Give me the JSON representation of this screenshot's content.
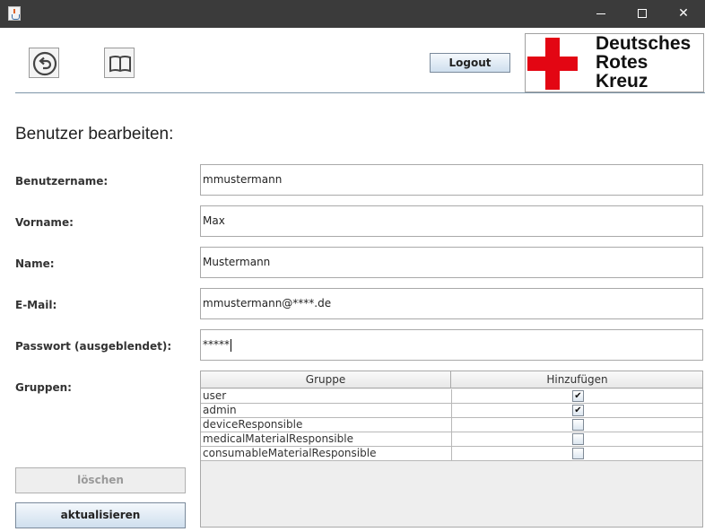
{
  "window": {
    "minimize_icon": "minimize-icon",
    "maximize_icon": "maximize-icon",
    "close_icon": "close-icon",
    "close_glyph": "✕"
  },
  "toolbar": {
    "back_icon": "back-arrow-icon",
    "manual_icon": "book-icon",
    "logout_label": "Logout"
  },
  "logo": {
    "lines": [
      "Deutsches",
      "Rotes",
      "Kreuz"
    ],
    "color": "#e30613"
  },
  "page": {
    "heading": "Benutzer bearbeiten:"
  },
  "form": {
    "username": {
      "label": "Benutzername:",
      "value": "mmustermann"
    },
    "firstname": {
      "label": "Vorname:",
      "value": "Max"
    },
    "lastname": {
      "label": "Name:",
      "value": "Mustermann"
    },
    "email": {
      "label": "E-Mail:",
      "value": "mmustermann@****.de"
    },
    "password": {
      "label": "Passwort (ausgeblendet):",
      "value": "*****"
    },
    "groups_label": "Gruppen:"
  },
  "groups_table": {
    "columns": [
      "Gruppe",
      "Hinzufügen"
    ],
    "rows": [
      {
        "name": "user",
        "checked": true
      },
      {
        "name": "admin",
        "checked": true
      },
      {
        "name": "deviceResponsible",
        "checked": false
      },
      {
        "name": "medicalMaterialResponsible",
        "checked": false
      },
      {
        "name": "consumableMaterialResponsible",
        "checked": false
      }
    ]
  },
  "actions": {
    "delete_label": "löschen",
    "update_label": "aktualisieren"
  },
  "colors": {
    "titlebar": "#3b3b3b",
    "accent_blue": "#cfdfee",
    "separator": "#7d95a8"
  }
}
